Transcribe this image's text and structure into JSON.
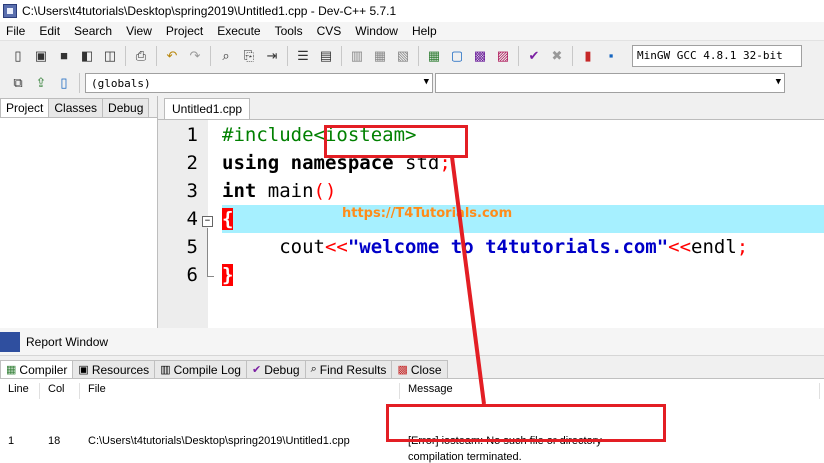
{
  "window": {
    "title": "C:\\Users\\t4tutorials\\Desktop\\spring2019\\Untitled1.cpp - Dev-C++ 5.7.1"
  },
  "menu": [
    "File",
    "Edit",
    "Search",
    "View",
    "Project",
    "Execute",
    "Tools",
    "CVS",
    "Window",
    "Help"
  ],
  "toolbar": {
    "compiler": "MinGW GCC 4.8.1 32-bit"
  },
  "toolbar2": {
    "scope": "(globals)",
    "symbol": ""
  },
  "left_tabs": [
    "Project",
    "Classes",
    "Debug"
  ],
  "file_tab": "Untitled1.cpp",
  "editor": {
    "lines": [
      {
        "n": "1",
        "parts": [
          {
            "t": "#include",
            "c": "pre"
          },
          {
            "t": "<iosteam>",
            "c": "pre"
          }
        ]
      },
      {
        "n": "2",
        "parts": [
          {
            "t": "using namespace",
            "c": "kw"
          },
          {
            "t": " std",
            "c": ""
          },
          {
            "t": ";",
            "c": "op"
          }
        ]
      },
      {
        "n": "3",
        "parts": [
          {
            "t": "int",
            "c": "kw"
          },
          {
            "t": " main",
            "c": ""
          },
          {
            "t": "()",
            "c": "op"
          }
        ]
      },
      {
        "n": "4",
        "parts": [
          {
            "t": "{",
            "c": "brace"
          }
        ]
      },
      {
        "n": "5",
        "parts": [
          {
            "t": "     cout",
            "c": ""
          },
          {
            "t": "<<",
            "c": "op"
          },
          {
            "t": "\"welcome to t4tutorials.com\"",
            "c": "str"
          },
          {
            "t": "<<",
            "c": "op"
          },
          {
            "t": "endl",
            "c": ""
          },
          {
            "t": ";",
            "c": "op"
          }
        ]
      },
      {
        "n": "6",
        "parts": [
          {
            "t": "}",
            "c": "brace"
          }
        ]
      }
    ],
    "watermark": "https://T4Tutorials.com"
  },
  "report": {
    "title": "Report Window",
    "tabs": [
      "Compiler",
      "Resources",
      "Compile Log",
      "Debug",
      "Find Results",
      "Close"
    ],
    "columns": [
      "Line",
      "Col",
      "File",
      "Message"
    ],
    "row": {
      "line": "1",
      "col": "18",
      "file": "C:\\Users\\t4tutorials\\Desktop\\spring2019\\Untitled1.cpp",
      "message1": "[Error] iosteam: No such file or directory",
      "message2": "compilation terminated."
    }
  },
  "colors": {
    "highlight": "#a6f0ff",
    "annotation": "#e31e24",
    "watermark": "#ff8c1a"
  }
}
